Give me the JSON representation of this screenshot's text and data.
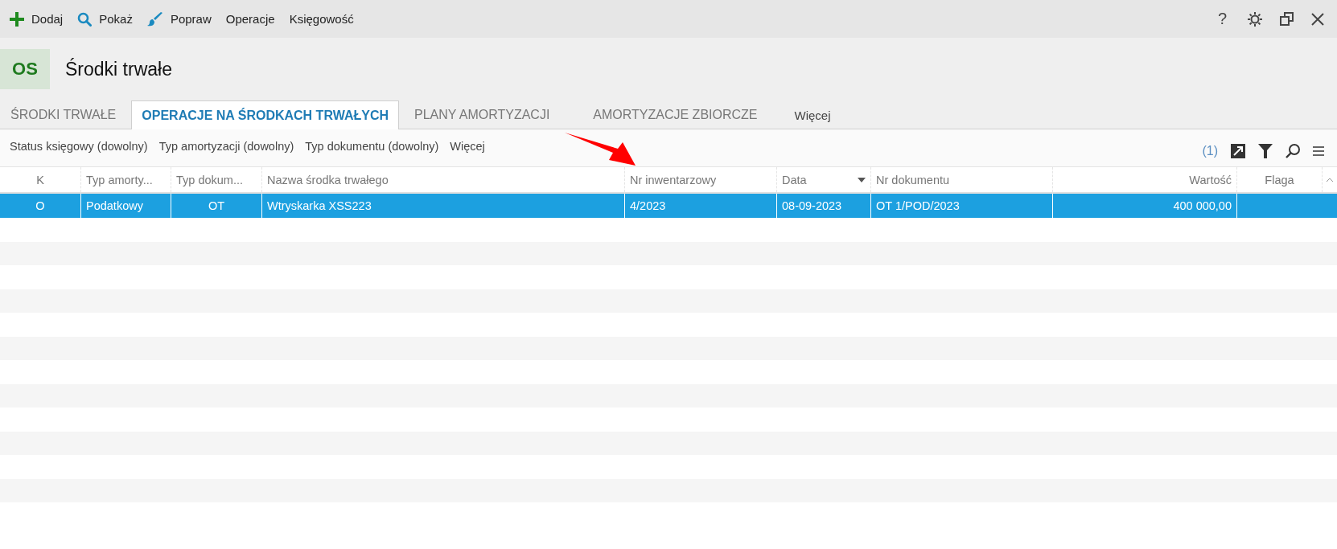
{
  "toolbar": {
    "actions": [
      {
        "label": "Dodaj",
        "kind": "add"
      },
      {
        "label": "Pokaż",
        "kind": "search"
      },
      {
        "label": "Popraw",
        "kind": "edit"
      },
      {
        "label": "Operacje",
        "kind": "text"
      },
      {
        "label": "Księgowość",
        "kind": "text"
      }
    ],
    "window_controls": [
      {
        "kind": "help",
        "label": "?"
      },
      {
        "kind": "settings"
      },
      {
        "kind": "restore"
      },
      {
        "kind": "close"
      }
    ]
  },
  "header": {
    "badge": "OS",
    "title": "Środki trwałe"
  },
  "tabs": [
    {
      "label": "ŚRODKI TRWAŁE",
      "selected": false
    },
    {
      "label": "OPERACJE NA ŚRODKACH TRWAŁYCH",
      "selected": true
    },
    {
      "label": "PLANY AMORTYZACJI",
      "selected": false
    },
    {
      "label": "AMORTYZACJE ZBIORCZE",
      "selected": false
    },
    {
      "label": "Więcej",
      "selected": false
    }
  ],
  "filters": [
    "Status księgowy (dowolny)",
    "Typ amortyzacji (dowolny)",
    "Typ dokumentu (dowolny)",
    "Więcej"
  ],
  "filter_count": "(1)",
  "table": {
    "columns": [
      {
        "label": "K",
        "sorted": false
      },
      {
        "label": "Typ amorty...",
        "sorted": false
      },
      {
        "label": "Typ dokum...",
        "sorted": false
      },
      {
        "label": "Nazwa środka trwałego",
        "sorted": false
      },
      {
        "label": "Nr inwentarzowy",
        "sorted": false
      },
      {
        "label": "Data",
        "sorted": true
      },
      {
        "label": "Nr dokumentu",
        "sorted": false
      },
      {
        "label": "Wartość",
        "sorted": false
      },
      {
        "label": "Flaga",
        "sorted": false
      }
    ],
    "rows": [
      {
        "selected": true,
        "cells": [
          "O",
          "Podatkowy",
          "OT",
          "Wtryskarka XSS223",
          "4/2023",
          "08-09-2023",
          "OT 1/POD/2023",
          "400 000,00",
          ""
        ]
      }
    ]
  },
  "annotations": [
    {
      "kind": "arrow",
      "color": "#ff0000"
    }
  ]
}
